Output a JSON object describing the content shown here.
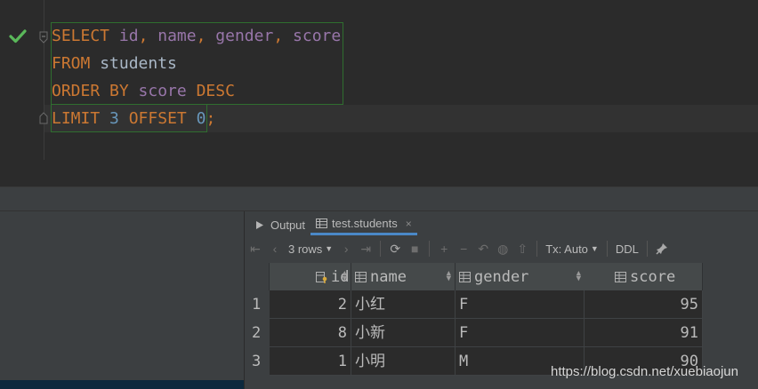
{
  "editor": {
    "lines": [
      [
        {
          "t": "SELECT",
          "c": "kw"
        },
        {
          "t": " ",
          "c": "plain"
        },
        {
          "t": "id",
          "c": "col"
        },
        {
          "t": ", ",
          "c": "kw"
        },
        {
          "t": "name",
          "c": "col"
        },
        {
          "t": ", ",
          "c": "kw"
        },
        {
          "t": "gender",
          "c": "col"
        },
        {
          "t": ", ",
          "c": "kw"
        },
        {
          "t": "score",
          "c": "col"
        }
      ],
      [
        {
          "t": "FROM",
          "c": "kw"
        },
        {
          "t": " students",
          "c": "plain"
        }
      ],
      [
        {
          "t": "ORDER BY",
          "c": "kw"
        },
        {
          "t": " ",
          "c": "plain"
        },
        {
          "t": "score",
          "c": "col"
        },
        {
          "t": " ",
          "c": "plain"
        },
        {
          "t": "DESC",
          "c": "kw"
        }
      ],
      [
        {
          "t": "LIMIT",
          "c": "kw"
        },
        {
          "t": " ",
          "c": "plain"
        },
        {
          "t": "3",
          "c": "num"
        },
        {
          "t": " ",
          "c": "plain"
        },
        {
          "t": "OFFSET",
          "c": "kw"
        },
        {
          "t": " ",
          "c": "plain"
        },
        {
          "t": "0",
          "c": "num"
        },
        {
          "t": ";",
          "c": "kw"
        }
      ]
    ]
  },
  "tabs": [
    {
      "label": "Output",
      "icon": "console-icon",
      "active": false
    },
    {
      "label": "test.students",
      "icon": "table-icon",
      "active": true,
      "close": "×"
    }
  ],
  "toolbar": {
    "rows_label": "3 rows",
    "tx_label": "Tx: Auto",
    "ddl_label": "DDL"
  },
  "grid": {
    "columns": [
      {
        "name": "id",
        "icon": "key-column-icon"
      },
      {
        "name": "name",
        "icon": "column-icon"
      },
      {
        "name": "gender",
        "icon": "column-icon"
      },
      {
        "name": "score",
        "icon": "column-icon"
      }
    ],
    "rows": [
      {
        "n": "1",
        "id": "2",
        "name": "小红",
        "gender": "F",
        "score": "95"
      },
      {
        "n": "2",
        "id": "8",
        "name": "小新",
        "gender": "F",
        "score": "91"
      },
      {
        "n": "3",
        "id": "1",
        "name": "小明",
        "gender": "M",
        "score": "90"
      }
    ]
  },
  "watermark": "https://blog.csdn.net/xuebiaojun",
  "colors": {
    "keyword": "#cc7832",
    "column": "#9876aa",
    "number": "#6897bb",
    "text": "#a9b7c6",
    "success": "#5ab85a"
  }
}
